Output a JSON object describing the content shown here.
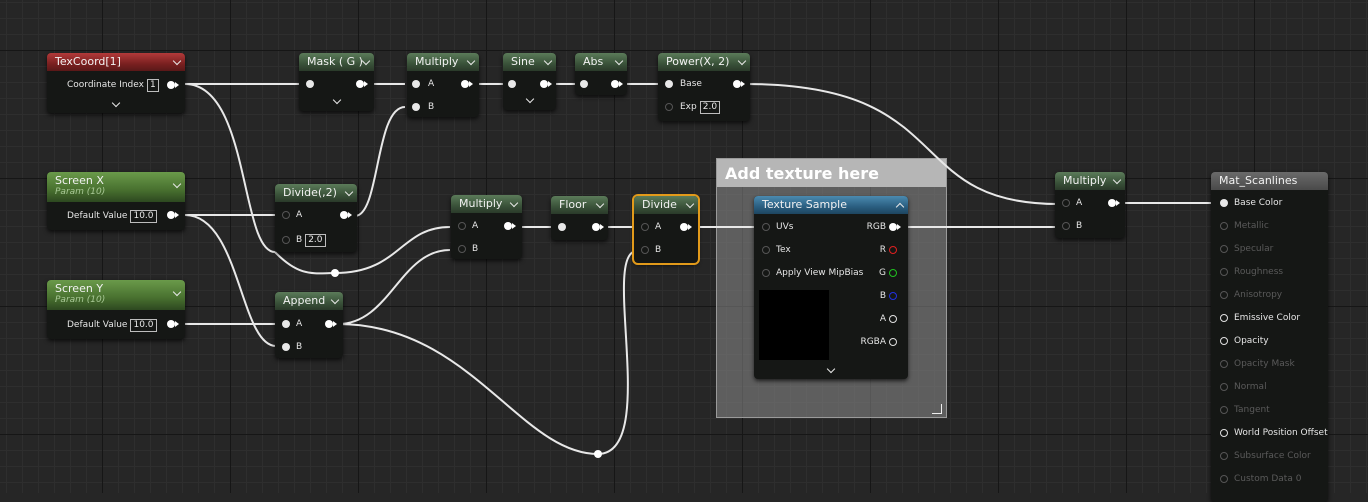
{
  "graph": {
    "nodes": {
      "texcoord": {
        "title": "TexCoord[1]",
        "coord_label": "Coordinate Index",
        "coord_value": "1"
      },
      "mask": {
        "title": "Mask ( G )"
      },
      "multiply_top": {
        "title": "Multiply",
        "a": "A",
        "b": "B"
      },
      "sine": {
        "title": "Sine"
      },
      "abs": {
        "title": "Abs"
      },
      "power": {
        "title": "Power(X, 2)",
        "base": "Base",
        "exp": "Exp",
        "exp_value": "2.0"
      },
      "screen_x": {
        "title": "Screen X",
        "sub": "Param (10)",
        "default_label": "Default Value",
        "default_value": "10.0"
      },
      "divide2": {
        "title": "Divide(,2)",
        "a": "A",
        "b": "B",
        "b_value": "2.0"
      },
      "multiply_mid": {
        "title": "Multiply",
        "a": "A",
        "b": "B"
      },
      "floor": {
        "title": "Floor"
      },
      "divide": {
        "title": "Divide",
        "a": "A",
        "b": "B"
      },
      "screen_y": {
        "title": "Screen Y",
        "sub": "Param (10)",
        "default_label": "Default Value",
        "default_value": "10.0"
      },
      "append": {
        "title": "Append",
        "a": "A",
        "b": "B"
      },
      "texture_sample": {
        "title": "Texture Sample",
        "inputs": [
          "UVs",
          "Tex",
          "Apply View MipBias"
        ],
        "outputs": [
          "RGB",
          "R",
          "G",
          "B",
          "A",
          "RGBA"
        ]
      },
      "multiply_right": {
        "title": "Multiply",
        "a": "A",
        "b": "B"
      },
      "material": {
        "title": "Mat_Scanlines",
        "pins": [
          "Base Color",
          "Metallic",
          "Specular",
          "Roughness",
          "Anisotropy",
          "Emissive Color",
          "Opacity",
          "Opacity Mask",
          "Normal",
          "Tangent",
          "World Position Offset",
          "Subsurface Color",
          "Custom Data 0"
        ]
      }
    },
    "comment": {
      "title": "Add texture here"
    }
  },
  "colors": {
    "pin_r": "#e02020",
    "pin_g": "#20c020",
    "pin_b": "#2030e0",
    "selected_outline": "#e29a1a"
  }
}
